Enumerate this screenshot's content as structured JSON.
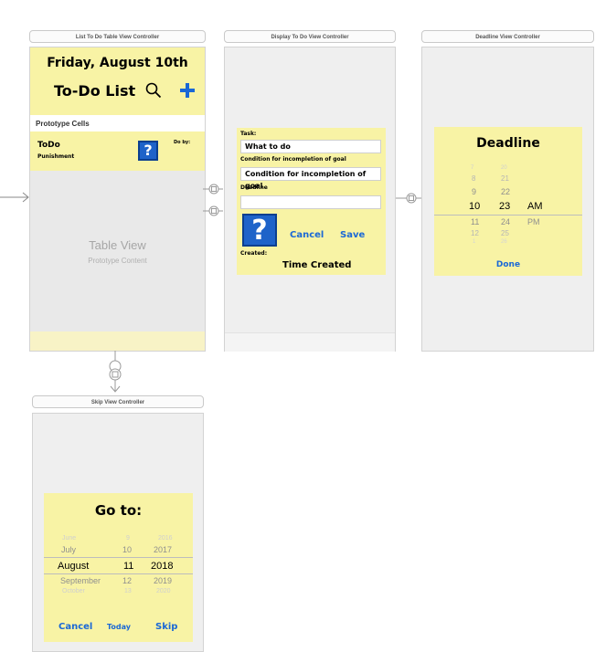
{
  "controllers": {
    "list": {
      "title": "List To Do Table View Controller",
      "date": "Friday, August 10th",
      "heading": "To-Do List",
      "search_icon": "magnifier-icon",
      "add_icon": "plus-icon",
      "section": "Prototype Cells",
      "cell_title": "ToDo",
      "cell_subtitle": "Punishment",
      "cell_doby": "Do by:",
      "cell_icon": "?",
      "table_title": "Table View",
      "table_subtitle": "Prototype Content"
    },
    "display": {
      "title": "Display To Do View Controller",
      "task_label": "Task:",
      "task_value": "What to do",
      "condition_label": "Condition for incompletion of goal",
      "condition_value": "Condition for incompletion of goal",
      "deadline_label": "Deadline",
      "deadline_value": "",
      "icon": "?",
      "cancel": "Cancel",
      "save": "Save",
      "created_label": "Created:",
      "created_value": "Time Created"
    },
    "deadline": {
      "title": "Deadline View Controller",
      "heading": "Deadline",
      "done": "Done",
      "picker": {
        "hours": [
          "7",
          "8",
          "9",
          "10",
          "11",
          "12",
          "1"
        ],
        "minutes": [
          "20",
          "21",
          "22",
          "23",
          "24",
          "25",
          "26"
        ],
        "ampm": [
          "",
          "",
          "",
          "AM",
          "PM",
          "",
          ""
        ]
      }
    },
    "skip": {
      "title": "Skip View Controller",
      "heading": "Go to:",
      "picker": {
        "months": [
          "June",
          "July",
          "August",
          "September",
          "October"
        ],
        "days": [
          "9",
          "10",
          "11",
          "12",
          "13"
        ],
        "years": [
          "2016",
          "2017",
          "2018",
          "2019",
          "2020"
        ]
      },
      "cancel": "Cancel",
      "today": "Today",
      "skip": "Skip"
    }
  },
  "colors": {
    "panel_yellow": "#f8f3a5",
    "accent_blue": "#1a68d6"
  }
}
